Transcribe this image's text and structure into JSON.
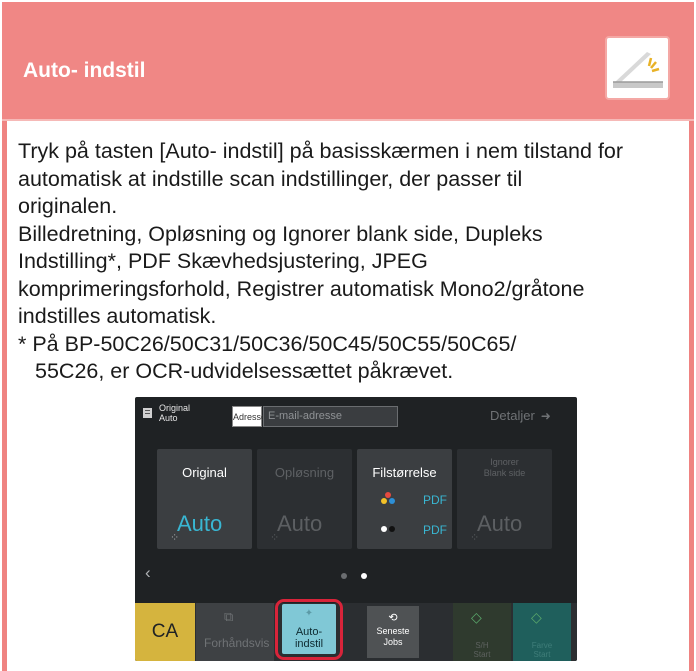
{
  "header": {
    "title": "Auto- indstil",
    "icon": "scanner-auto-icon",
    "color": "#f08785"
  },
  "body": {
    "paragraph1_line1": "Tryk på tasten [Auto- indstil] på basisskærmen i nem tilstand for",
    "paragraph1_line2": "automatisk at indstille scan indstillinger, der passer til",
    "paragraph1_line3": "originalen.",
    "paragraph2_line1": "Billedretning, Opløsning og Ignorer blank side, Dupleks",
    "paragraph2_line2": "Indstilling*, PDF Skævhedsjustering, JPEG",
    "paragraph2_line3": "komprimeringsforhold, Registrer automatisk Mono2/gråtone",
    "paragraph2_line4": "indstilles automatisk.",
    "note_line1": "* På BP-50C26/50C31/50C36/50C45/50C55/50C65/",
    "note_line2": "55C26, er OCR-udvidelsessættet påkrævet."
  },
  "screen": {
    "original_label_1": "Original",
    "original_label_2": "Auto",
    "address_tag": "Adresse",
    "email_placeholder": "E-mail-adresse",
    "details": "Detaljer",
    "tiles": [
      {
        "label": "Original",
        "value": "Auto"
      },
      {
        "label": "Opløsning",
        "value": "Auto"
      },
      {
        "label": "Filstørrelse",
        "pdf1": "PDF",
        "pdf2": "PDF"
      },
      {
        "label_1": "Ignorer",
        "label_2": "Blank side",
        "value": "Auto"
      }
    ],
    "buttons": {
      "ca": "CA",
      "preview": "Forhåndsvis",
      "auto_1": "Auto-",
      "auto_2": "indstil",
      "recent_1": "Seneste",
      "recent_2": "Jobs",
      "mono_1": "S/H",
      "mono_2": "Start",
      "color_1": "Farve",
      "color_2": "Start"
    },
    "accent": "#39b6d2",
    "highlight": "#d8243a"
  }
}
